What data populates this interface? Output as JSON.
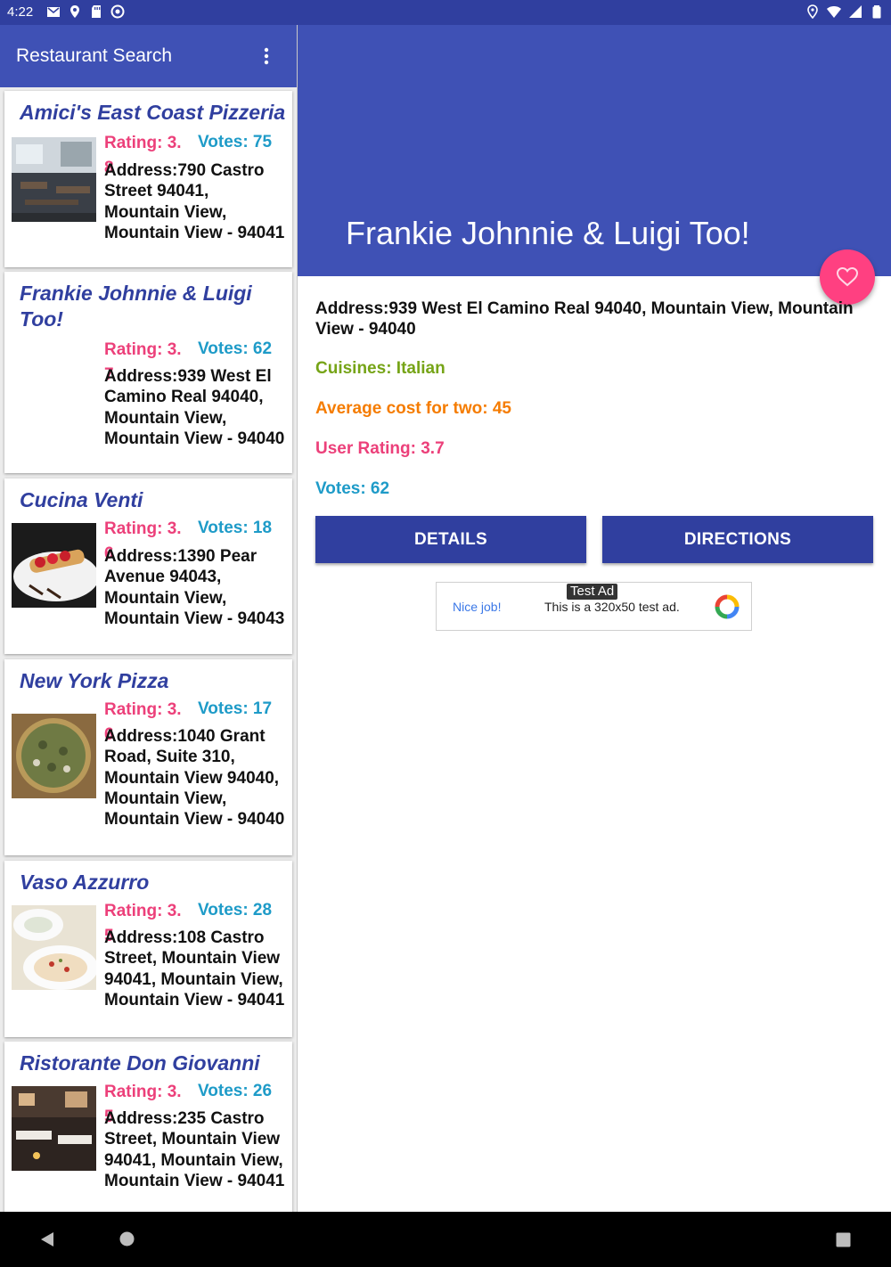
{
  "status_bar": {
    "time": "4:22",
    "left_icons": [
      "gmail-icon",
      "location-icon",
      "sd-card-icon",
      "sync-icon"
    ],
    "right_icons": [
      "location-icon",
      "wifi-icon",
      "signal-icon",
      "battery-icon"
    ]
  },
  "app_bar": {
    "title": "Restaurant Search",
    "menu_icon": "more-vert-icon"
  },
  "restaurants": [
    {
      "name": "Amici's East Coast Pizzeria",
      "rating": "Rating: 3.8",
      "votes": "Votes: 75",
      "address": "Address:790 Castro Street 94041, Mountain View, Mountain View - 94041",
      "image": "restaurant-interior-photo"
    },
    {
      "name": "Frankie Johnnie & Luigi Too!",
      "rating": "Rating: 3.7",
      "votes": "Votes: 62",
      "address": "Address:939 West El Camino Real 94040, Mountain View, Mountain View - 94040",
      "image": ""
    },
    {
      "name": "Cucina Venti",
      "rating": "Rating: 3.6",
      "votes": "Votes: 18",
      "address": "Address:1390 Pear Avenue 94043, Mountain View, Mountain View - 94043",
      "image": "dessert-plate-photo"
    },
    {
      "name": "New York Pizza",
      "rating": "Rating: 3.6",
      "votes": "Votes: 17",
      "address": "Address:1040 Grant Road, Suite 310, Mountain View 94040, Mountain View, Mountain View - 94040",
      "image": "pizza-photo"
    },
    {
      "name": "Vaso Azzurro",
      "rating": "Rating: 3.5",
      "votes": "Votes: 28",
      "address": "Address:108 Castro Street, Mountain View 94041, Mountain View, Mountain View - 94041",
      "image": "pasta-plate-photo"
    },
    {
      "name": "Ristorante Don Giovanni",
      "rating": "Rating: 3.5",
      "votes": "Votes: 26",
      "address": "Address:235 Castro Street, Mountain View 94041, Mountain View, Mountain View - 94041",
      "image": "dining-room-photo"
    }
  ],
  "detail": {
    "title": "Frankie Johnnie & Luigi Too!",
    "address": "Address:939 West El Camino Real 94040, Mountain View, Mountain View - 94040",
    "cuisines": "Cuisines: Italian",
    "cost": "Average cost for two: 45",
    "user_rating": "User Rating: 3.7",
    "votes": "Votes: 62",
    "details_button": "DETAILS",
    "directions_button": "DIRECTIONS",
    "favorite_icon": "heart-outline-icon"
  },
  "ad": {
    "nice": "Nice job!",
    "text": "This is a 320x50 test ad.",
    "badge": "Test Ad"
  },
  "colors": {
    "primary": "#3f51b5",
    "primary_dark": "#303f9f",
    "accent": "#ff4081",
    "rating": "#ec407a",
    "votes": "#1e9bc8",
    "cuisines": "#76a417",
    "cost": "#f57c00"
  }
}
